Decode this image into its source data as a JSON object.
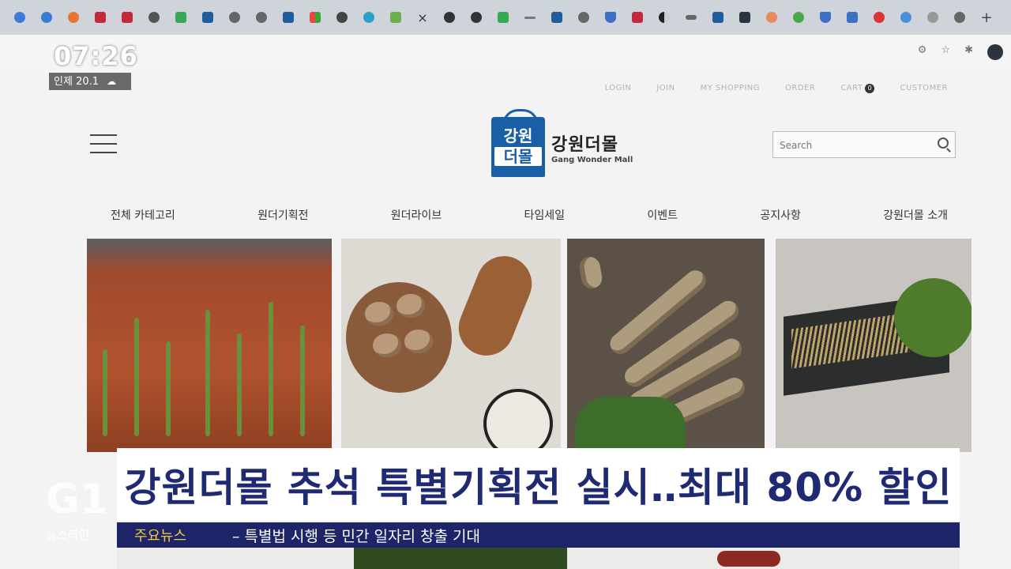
{
  "browser": {
    "tab_icons": [
      "edge-icon",
      "edge-icon",
      "firefox-icon",
      "red-app-icon",
      "red-app-icon",
      "chrome-icon",
      "green-app-icon",
      "fn-icon",
      "chrome-icon",
      "chrome-icon",
      "fn-icon",
      "windows-icon",
      "chrome-icon",
      "circle-app-icon",
      "green-app-icon"
    ],
    "active_tab_close": "×",
    "tab_icons_right": [
      "korea-icon",
      "korea-icon",
      "green-app-icon",
      "dash-icon",
      "blue-app-icon",
      "chrome-icon",
      "shield-icon",
      "red-app-icon",
      "half-circle-icon",
      "menu-icon",
      "blue-app-icon",
      "dark-app-icon",
      "orange-app-icon",
      "circle-app-icon",
      "shield-icon",
      "chart-icon",
      "red-pin-icon",
      "globe-icon",
      "gear-icon",
      "chrome-icon"
    ],
    "new_tab": "+"
  },
  "overlay": {
    "time": "07:26",
    "weather_city": "인제",
    "weather_temp": "20.1",
    "headline": "강원더몰 추석 특별기획전 실시‥최대 80% 할인",
    "ticker_label": "주요뉴스",
    "ticker_text": "– 특별법 시행 등 민간 일자리 창출 기대",
    "channel_logo": "G1",
    "channel_sub": "뉴스라인"
  },
  "site": {
    "top_links": [
      "LOGIN",
      "JOIN",
      "MY SHOPPING",
      "ORDER",
      "CART",
      "CUSTOMER"
    ],
    "cart_count": "0",
    "logo_row1": "강원",
    "logo_row2": "더몰",
    "logo_name_ko": "강원더몰",
    "logo_name_en": "Gang Wonder Mall",
    "search_placeholder": "Search",
    "nav": [
      "전체 카테고리",
      "원더기획전",
      "원더라이브",
      "타임세일",
      "이벤트",
      "공지사항",
      "강원더몰 소개"
    ]
  },
  "colors": {
    "headline_text": "#1f2a72",
    "ticker_bg": "#1d2568",
    "ticker_label": "#f2c93f",
    "logo_blue": "#1a5fa6"
  }
}
